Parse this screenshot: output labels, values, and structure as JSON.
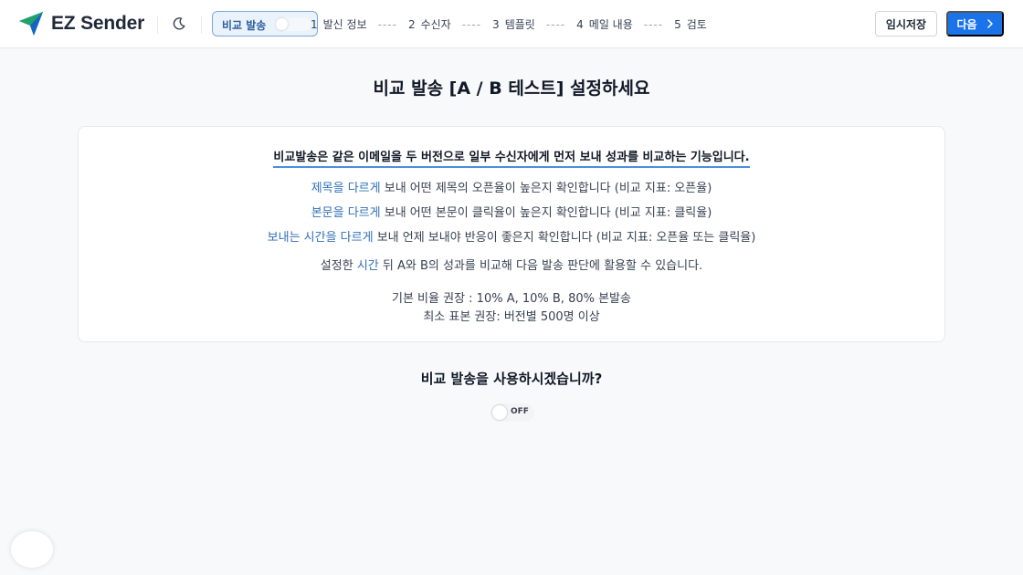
{
  "app": {
    "name": "EZ Sender"
  },
  "header": {
    "compare_toggle_label": "비교 발송",
    "steps": [
      {
        "num": "1",
        "label": "발신 정보"
      },
      {
        "num": "2",
        "label": "수신자"
      },
      {
        "num": "3",
        "label": "템플릿"
      },
      {
        "num": "4",
        "label": "메일 내용"
      },
      {
        "num": "5",
        "label": "검토"
      }
    ],
    "step_separator": "----",
    "draft_label": "임시저장",
    "next_label": "다음"
  },
  "main": {
    "title": "비교 발송 [A / B 테스트] 설정하세요",
    "intro": "비교발송은 같은 이메일을 두 버전으로 일부 수신자에게 먼저 보내 성과를 비교하는 기능입니다.",
    "options": [
      {
        "highlight": "제목을 다르게",
        "text": " 보내 어떤 제목의 오픈율이 높은지 확인합니다 (비교 지표: 오픈율)"
      },
      {
        "highlight": "본문을 다르게",
        "text": " 보내 어떤 본문이 클릭율이 높은지 확인합니다 (비교 지표: 클릭율)"
      },
      {
        "highlight": "보내는 시간을 다르게",
        "text": " 보내 언제 보내야 반응이 좋은지 확인합니다 (비교 지표: 오픈율 또는 클릭율)"
      }
    ],
    "note_prefix": "설정한 ",
    "note_highlight": "시간",
    "note_suffix": " 뒤 A와 B의 성과를 비교해 다음 발송 판단에 활용할 수 있습니다.",
    "ratio_text": "기본 비율 권장 : 10% A, 10% B, 80% 본발송",
    "sample_text": "최소 표본 권장: 버전별 500명 이상",
    "question": "비교 발송을 사용하시겠습니까?",
    "toggle_state": "OFF"
  },
  "colors": {
    "accent": "#1a73e8",
    "highlight_text": "#2e6fb8",
    "intro_underline": "#4a90d9",
    "pill_border": "#7ca7d6"
  }
}
